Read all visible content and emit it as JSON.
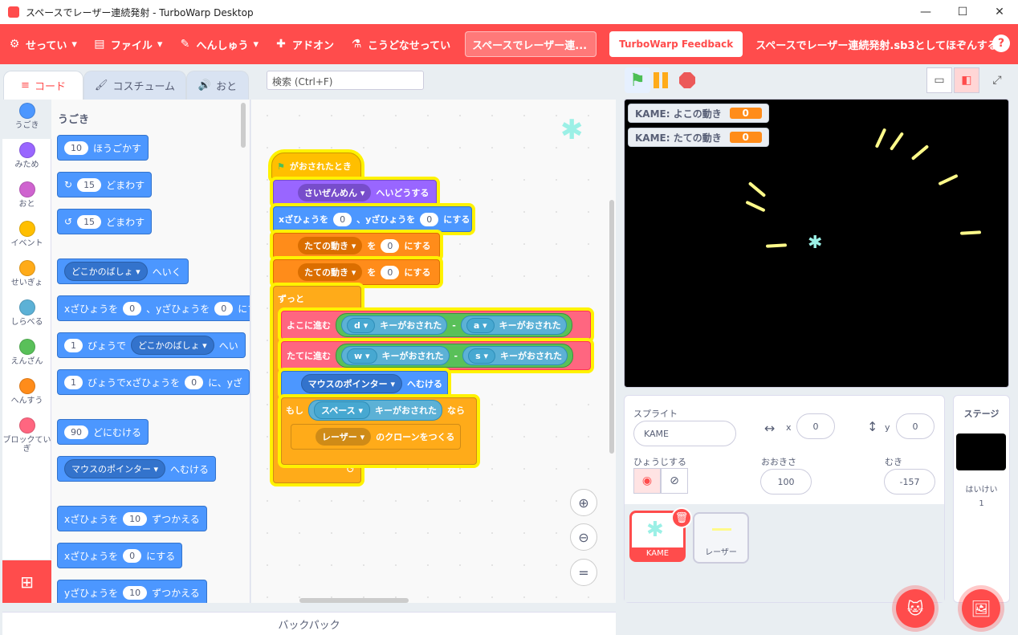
{
  "window": {
    "title": "スペースでレーザー連続発射 - TurboWarp Desktop"
  },
  "menu": {
    "settings": "せってい",
    "file": "ファイル",
    "edit": "へんしゅう",
    "addons": "アドオン",
    "debug": "こうどなせってい",
    "project_title": "スペースでレーザー連...",
    "feedback": "TurboWarp Feedback",
    "save_as": "スペースでレーザー連続発射.sb3としてほぞんする",
    "help": "?"
  },
  "tabs": {
    "code": "コード",
    "costumes": "コスチューム",
    "sounds": "おと"
  },
  "search": {
    "placeholder": "検索 (Ctrl+F)"
  },
  "categories": [
    {
      "label": "うごき",
      "color": "#4c97ff"
    },
    {
      "label": "みため",
      "color": "#9966ff"
    },
    {
      "label": "おと",
      "color": "#cf63cf"
    },
    {
      "label": "イベント",
      "color": "#ffbf00"
    },
    {
      "label": "せいぎょ",
      "color": "#ffab19"
    },
    {
      "label": "しらべる",
      "color": "#5cb1d6"
    },
    {
      "label": "えんざん",
      "color": "#59c059"
    },
    {
      "label": "へんすう",
      "color": "#ff8c1a"
    },
    {
      "label": "ブロックていぎ",
      "color": "#ff6680"
    }
  ],
  "palette": {
    "heading": "うごき",
    "move_steps": "10",
    "move_label": "ほうごかす",
    "turn_right_deg": "15",
    "turn_right_label": "どまわす",
    "turn_left_deg": "15",
    "turn_left_label": "どまわす",
    "goto_dd": "どこかのばしょ",
    "goto_label": "へいく",
    "gotoxy_a": "xざひょうを",
    "gotoxy_x": "0",
    "gotoxy_b": "、yざひょうを",
    "gotoxy_y": "0",
    "gotoxy_c": "にする",
    "glide_secs": "1",
    "glide_label": "びょうで",
    "glide_dd": "どこかのばしょ",
    "glide_tail": "へい",
    "glidexy_secs": "1",
    "glidexy_label": "びょうでxざひょうを",
    "glidexy_x": "0",
    "glidexy_tail": "に、yざ",
    "point_deg": "90",
    "point_label": "どにむける",
    "point_towards_dd": "マウスのポインター",
    "point_towards_label": "へむける",
    "changex_a": "xざひょうを",
    "changex_val": "10",
    "changex_b": "ずつかえる",
    "setx_a": "xざひょうを",
    "setx_val": "0",
    "setx_b": "にする",
    "changey_a": "yざひょうを",
    "changey_val": "10",
    "changey_b": "ずつかえる"
  },
  "script": {
    "hat": "がおされたとき",
    "layer_dd": "さいぜんめん",
    "layer_label": "へいどうする",
    "gotoxy_a": "xざひょうを",
    "gotoxy_x": "0",
    "gotoxy_b": "、yざひょうを",
    "gotoxy_y": "0",
    "gotoxy_c": "にする",
    "set1_dd": "たての動き",
    "set1_a": "を",
    "set1_val": "0",
    "set1_b": "にする",
    "set2_dd": "たての動き",
    "set2_a": "を",
    "set2_val": "0",
    "set2_b": "にする",
    "forever": "ずっと",
    "h_label": "よこに進む",
    "h_key1": "d",
    "h_key_label1": "キーがおされた",
    "minus1": "-",
    "h_key2": "a",
    "h_key_label2": "キーがおされた",
    "v_label": "たてに進む",
    "v_key1": "w",
    "v_key_label1": "キーがおされた",
    "minus2": "-",
    "v_key2": "s",
    "v_key_label2": "キーがおされた",
    "point_dd": "マウスのポインター",
    "point_label": "へむける",
    "if_label": "もし",
    "if_key": "スペース",
    "if_key_label": "キーがおされた",
    "if_then": "なら",
    "clone_dd": "レーザー",
    "clone_label": "のクローンをつくる",
    "loop_arrow": "↺"
  },
  "stage": {
    "monitor1_label": "KAME: よこの動き",
    "monitor1_value": "0",
    "monitor2_label": "KAME: たての動き",
    "monitor2_value": "0"
  },
  "sprite_info": {
    "sprite_label": "スプライト",
    "sprite_name": "KAME",
    "x_label": "x",
    "x_value": "0",
    "y_label": "y",
    "y_value": "0",
    "show_label": "ひょうじする",
    "size_label": "おおきさ",
    "size_value": "100",
    "direction_label": "むき",
    "direction_value": "-157"
  },
  "sprites": [
    {
      "name": "KAME",
      "selected": true
    },
    {
      "name": "レーザー",
      "selected": false
    }
  ],
  "stage_panel": {
    "title": "ステージ",
    "backdrops_label": "はいけい",
    "backdrops_count": "1"
  },
  "backpack": "バックパック"
}
